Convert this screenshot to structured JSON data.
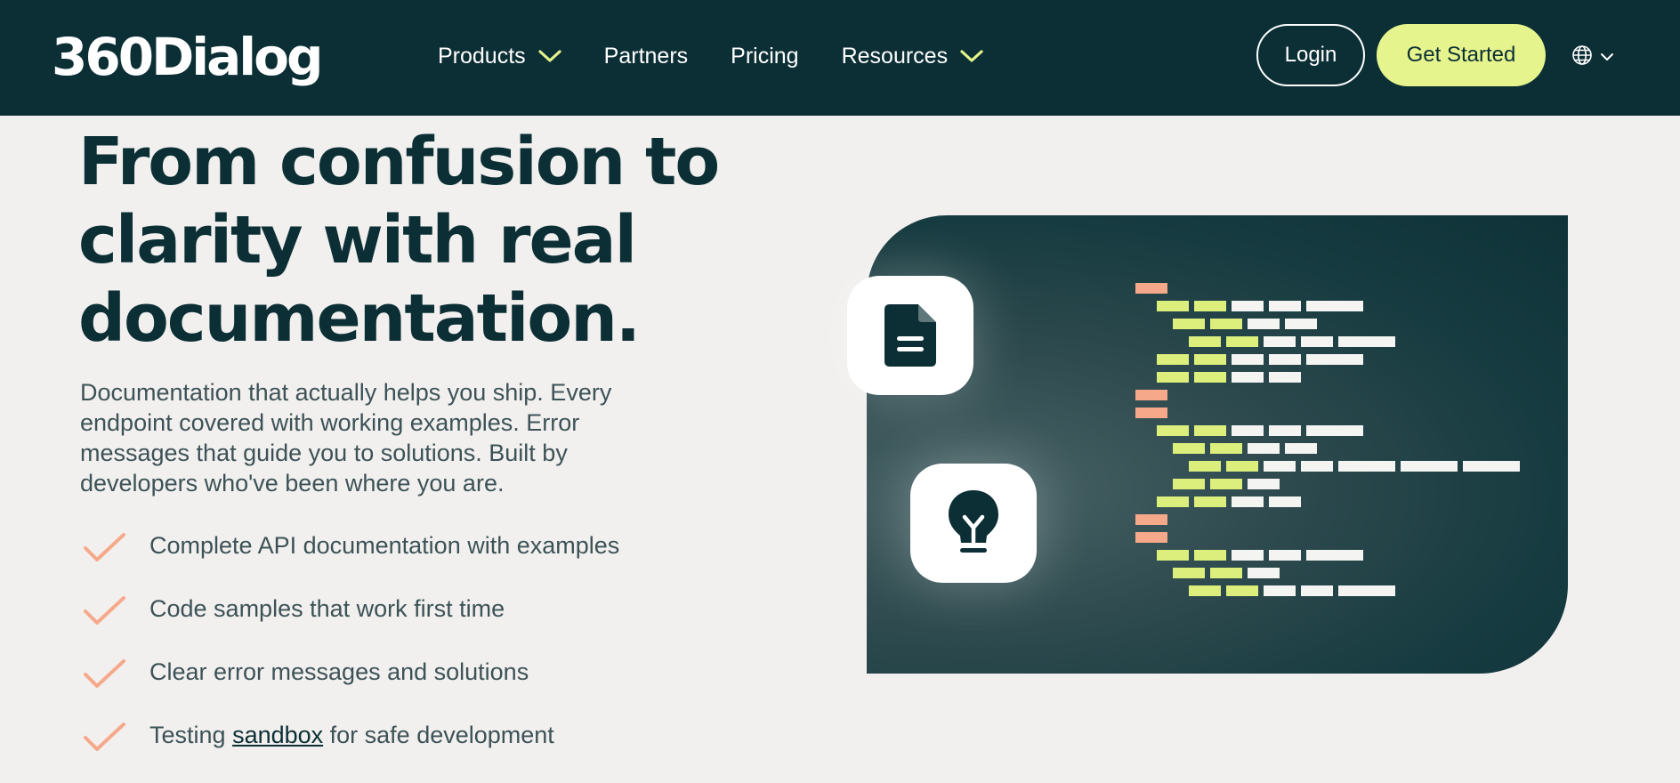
{
  "header": {
    "logo_text": "360Dialog",
    "nav": [
      {
        "label": "Products",
        "has_dropdown": true
      },
      {
        "label": "Partners",
        "has_dropdown": false
      },
      {
        "label": "Pricing",
        "has_dropdown": false
      },
      {
        "label": "Resources",
        "has_dropdown": true
      }
    ],
    "login_label": "Login",
    "get_started_label": "Get Started",
    "language_icon": "globe-icon"
  },
  "hero": {
    "title_lines": [
      "From confusion to",
      "clarity with real",
      "documentation."
    ],
    "description": "Documentation that actually helps you ship. Every endpoint covered with working examples. Error messages that guide you to solutions. Built by developers who've been where you are.",
    "features": [
      {
        "text": "Complete API documentation with examples"
      },
      {
        "text": "Code samples that work first time"
      },
      {
        "text": "Clear error messages and solutions"
      },
      {
        "text_before": "Testing ",
        "link": "sandbox",
        "text_after": " for safe development"
      }
    ],
    "illustration_icons": [
      "document-icon",
      "lightbulb-icon"
    ]
  },
  "colors": {
    "header_bg": "#0c2f35",
    "page_bg": "#f1f0ee",
    "accent_lime": "#e5f48c",
    "check_orange": "#f6a98a",
    "code_salmon": "#f6a98a",
    "code_lime": "#dcee7b",
    "code_white": "#f4f4f2"
  }
}
